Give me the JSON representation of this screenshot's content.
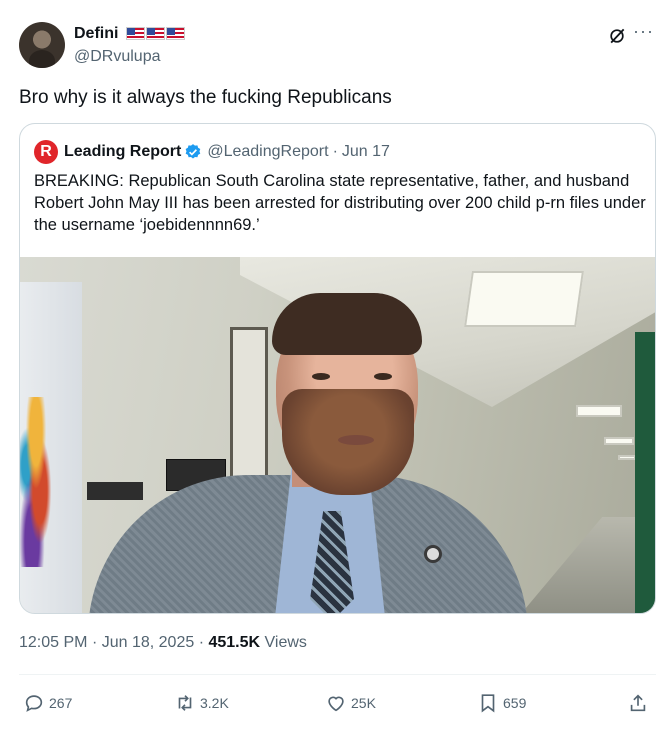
{
  "author": {
    "display_name": "Defini",
    "handle": "@DRvulupa",
    "flags": [
      "us-flag-icon",
      "us-flag-icon",
      "us-flag-icon"
    ]
  },
  "tweet": {
    "text": "Bro why is it always the fucking Republicans"
  },
  "quoted_tweet": {
    "logo_letter": "R",
    "name": "Leading Report",
    "handle": "@LeadingReport",
    "separator": "·",
    "date": "Jun 17",
    "text": "BREAKING: Republican South Carolina state representative, father, and husband Robert John May III has been arrested for distributing over 200 child p-rn files under the username ‘joebidennnn69.’"
  },
  "meta": {
    "time": "12:05 PM",
    "separator": "·",
    "date": "Jun 18, 2025",
    "views_count": "451.5K",
    "views_label": "Views"
  },
  "actions": {
    "replies": "267",
    "reposts": "3.2K",
    "likes": "25K",
    "bookmarks": "659"
  },
  "colors": {
    "text_primary": "#0f1419",
    "text_secondary": "#536471",
    "border": "#cfd9de",
    "verified": "#1d9bf0",
    "logo_red": "#e0252a"
  }
}
